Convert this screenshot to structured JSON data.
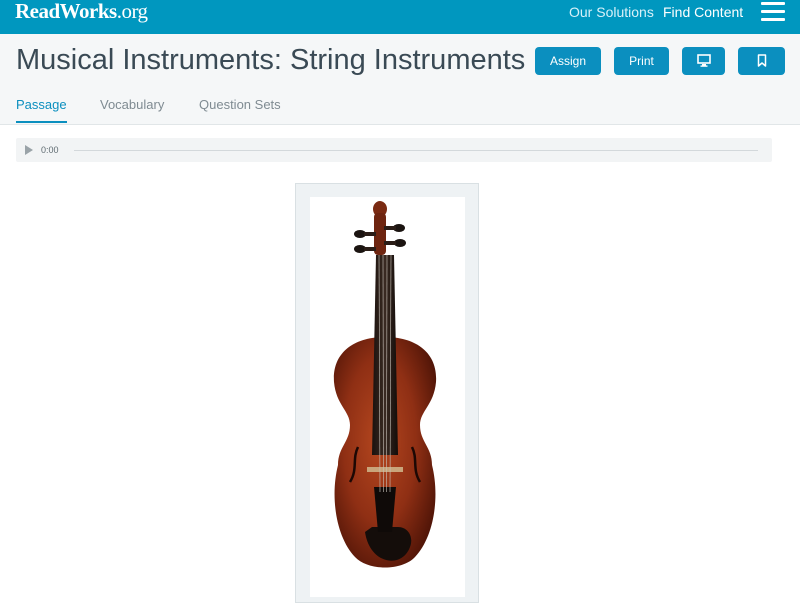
{
  "topbar": {
    "logo_main": "ReadWorks",
    "logo_tld": ".org",
    "nav": {
      "solutions": "Our Solutions",
      "find_content": "Find Content"
    },
    "menu_icon": "hamburger-menu-icon"
  },
  "header": {
    "title": "Musical Instruments: String Instruments",
    "buttons": {
      "assign": "Assign",
      "print": "Print",
      "present_icon": "monitor-icon",
      "bookmark_icon": "bookmark-icon"
    },
    "tabs": [
      {
        "label": "Passage",
        "active": true
      },
      {
        "label": "Vocabulary",
        "active": false
      },
      {
        "label": "Question Sets",
        "active": false
      }
    ]
  },
  "audio": {
    "time": "0:00",
    "play_icon": "play-icon"
  },
  "image": {
    "subject": "violin"
  },
  "colors": {
    "brand": "#0097bf",
    "accent": "#0b8fbf",
    "title": "#3a4a55",
    "tab_inactive": "#7f8b92"
  }
}
